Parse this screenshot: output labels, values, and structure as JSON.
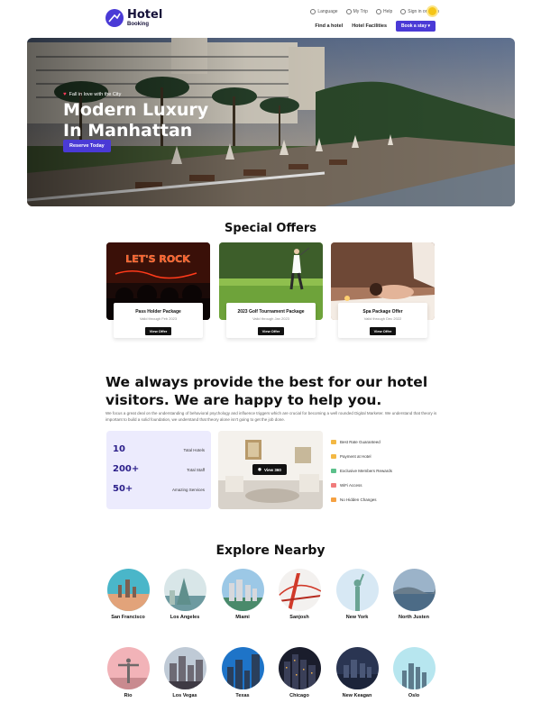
{
  "header": {
    "logo_title": "Hotel",
    "logo_subtitle": "Booking",
    "util_links": [
      "Language",
      "My Trip",
      "Help",
      "Sign in or Login"
    ],
    "nav_links": [
      "Find a hotel",
      "Hotel Facilities"
    ],
    "book_button": "Book a stay ▾"
  },
  "hero": {
    "tagline": "Fall in love with the City",
    "title_line1": "Modern Luxury",
    "title_line2": "In Manhattan",
    "cta": "Reserve Today"
  },
  "offers": {
    "title": "Special Offers",
    "items": [
      {
        "title": "Pass Holder Package",
        "valid": "Valid through Feb 2023",
        "button": "View Offer",
        "photo_sign": "LET'S ROCK"
      },
      {
        "title": "2023 Golf Tournament Package",
        "valid": "Valid through Jan 2023",
        "button": "View Offer"
      },
      {
        "title": "Spa Package Offer",
        "valid": "Valid through Dec 2022",
        "button": "View Offer"
      }
    ]
  },
  "about": {
    "title": "We always provide the best for our hotel visitors. We are happy to help you.",
    "body": "We focus a great deal on the understanding of behavioral psychology and influence triggers which are crucial for becoming a well rounded Digital Marketer. We understand that theory is important to build a solid foundation, we understand that theory alone isn't going to get the job done.",
    "stats": [
      {
        "value": "10",
        "label": "Total Hotels"
      },
      {
        "value": "200+",
        "label": "Total Staff"
      },
      {
        "value": "50+",
        "label": "Amazing Services"
      }
    ],
    "view_button": "View 360",
    "features": [
      "Best Rate Guaranteed",
      "Payment at Hotel",
      "Exclusive Members Rewards",
      "WiFi Access",
      "No Hidden Changes"
    ]
  },
  "explore": {
    "title": "Explore Nearby",
    "cities": [
      "San Francisco",
      "Los Angeles",
      "Miami",
      "Sanjosh",
      "New York",
      "North Justen",
      "Rio",
      "Los Vegas",
      "Texas",
      "Chicago",
      "New Keagan",
      "Oslo"
    ]
  }
}
